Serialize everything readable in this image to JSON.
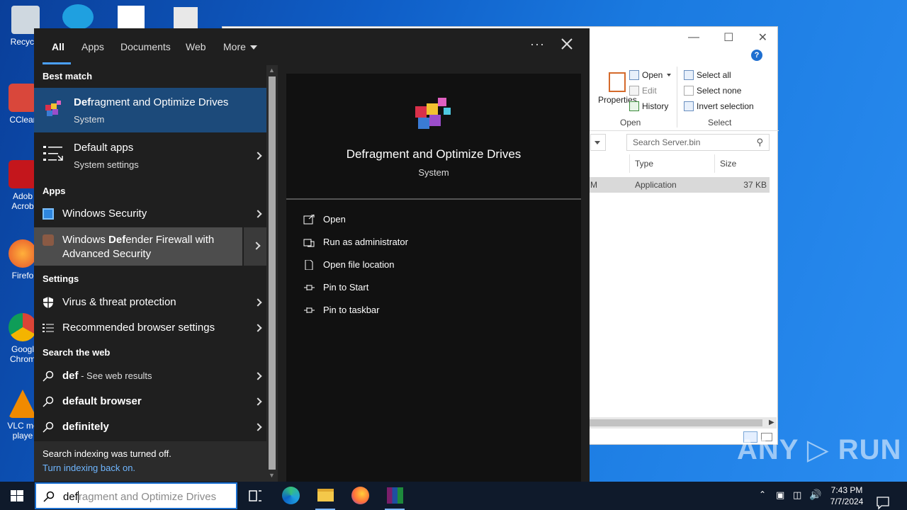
{
  "desktop": {
    "icons": [
      {
        "label": "Recycle"
      },
      {
        "label": "CClear"
      },
      {
        "label": "Adob\nAcrob"
      },
      {
        "label": "Firefo"
      },
      {
        "label": "Googl\nChrom"
      },
      {
        "label": "VLC me\nplaye"
      }
    ]
  },
  "explorer": {
    "ribbon": {
      "properties_label": "Properties",
      "open_label": "Open",
      "edit_label": "Edit",
      "history_label": "History",
      "open_group_label": "Open",
      "select_all_label": "Select all",
      "select_none_label": "Select none",
      "invert_selection_label": "Invert selection",
      "select_group_label": "Select"
    },
    "search_placeholder": "Search Server.bin",
    "columns": {
      "type": "Type",
      "size": "Size"
    },
    "row": {
      "partial": "M",
      "type": "Application",
      "size": "37 KB"
    }
  },
  "search": {
    "tabs": [
      "All",
      "Apps",
      "Documents",
      "Web",
      "More"
    ],
    "more_dots": "···",
    "sections": {
      "best_match": "Best match",
      "apps": "Apps",
      "settings": "Settings",
      "search_web": "Search the web"
    },
    "best_match": {
      "title_bold": "Def",
      "title_rest": "ragment and Optimize Drives",
      "subtitle": "System"
    },
    "default_apps": {
      "title": "Default apps",
      "subtitle": "System settings"
    },
    "apps": [
      {
        "title": "Windows Security"
      },
      {
        "title_pre": "Windows ",
        "title_bold": "Def",
        "title_rest": "ender Firewall with",
        "title_line2": "Advanced Security"
      }
    ],
    "settings": [
      {
        "title": "Virus & threat protection"
      },
      {
        "title": "Recommended browser settings"
      }
    ],
    "web": [
      {
        "bold": "def",
        "rest": " - See web results"
      },
      {
        "bold": "default browser",
        "rest": ""
      },
      {
        "bold": "definitely",
        "rest": ""
      }
    ],
    "indexing": {
      "message": "Search indexing was turned off.",
      "link": "Turn indexing back on."
    },
    "preview": {
      "title": "Defragment and Optimize Drives",
      "subtitle": "System",
      "actions": [
        "Open",
        "Run as administrator",
        "Open file location",
        "Pin to Start",
        "Pin to taskbar"
      ]
    }
  },
  "taskbar": {
    "search_typed": "def",
    "search_ghost": "ragment and Optimize Drives",
    "time": "7:43 PM",
    "date": "7/7/2024"
  },
  "watermark": "ANY ▷ RUN"
}
